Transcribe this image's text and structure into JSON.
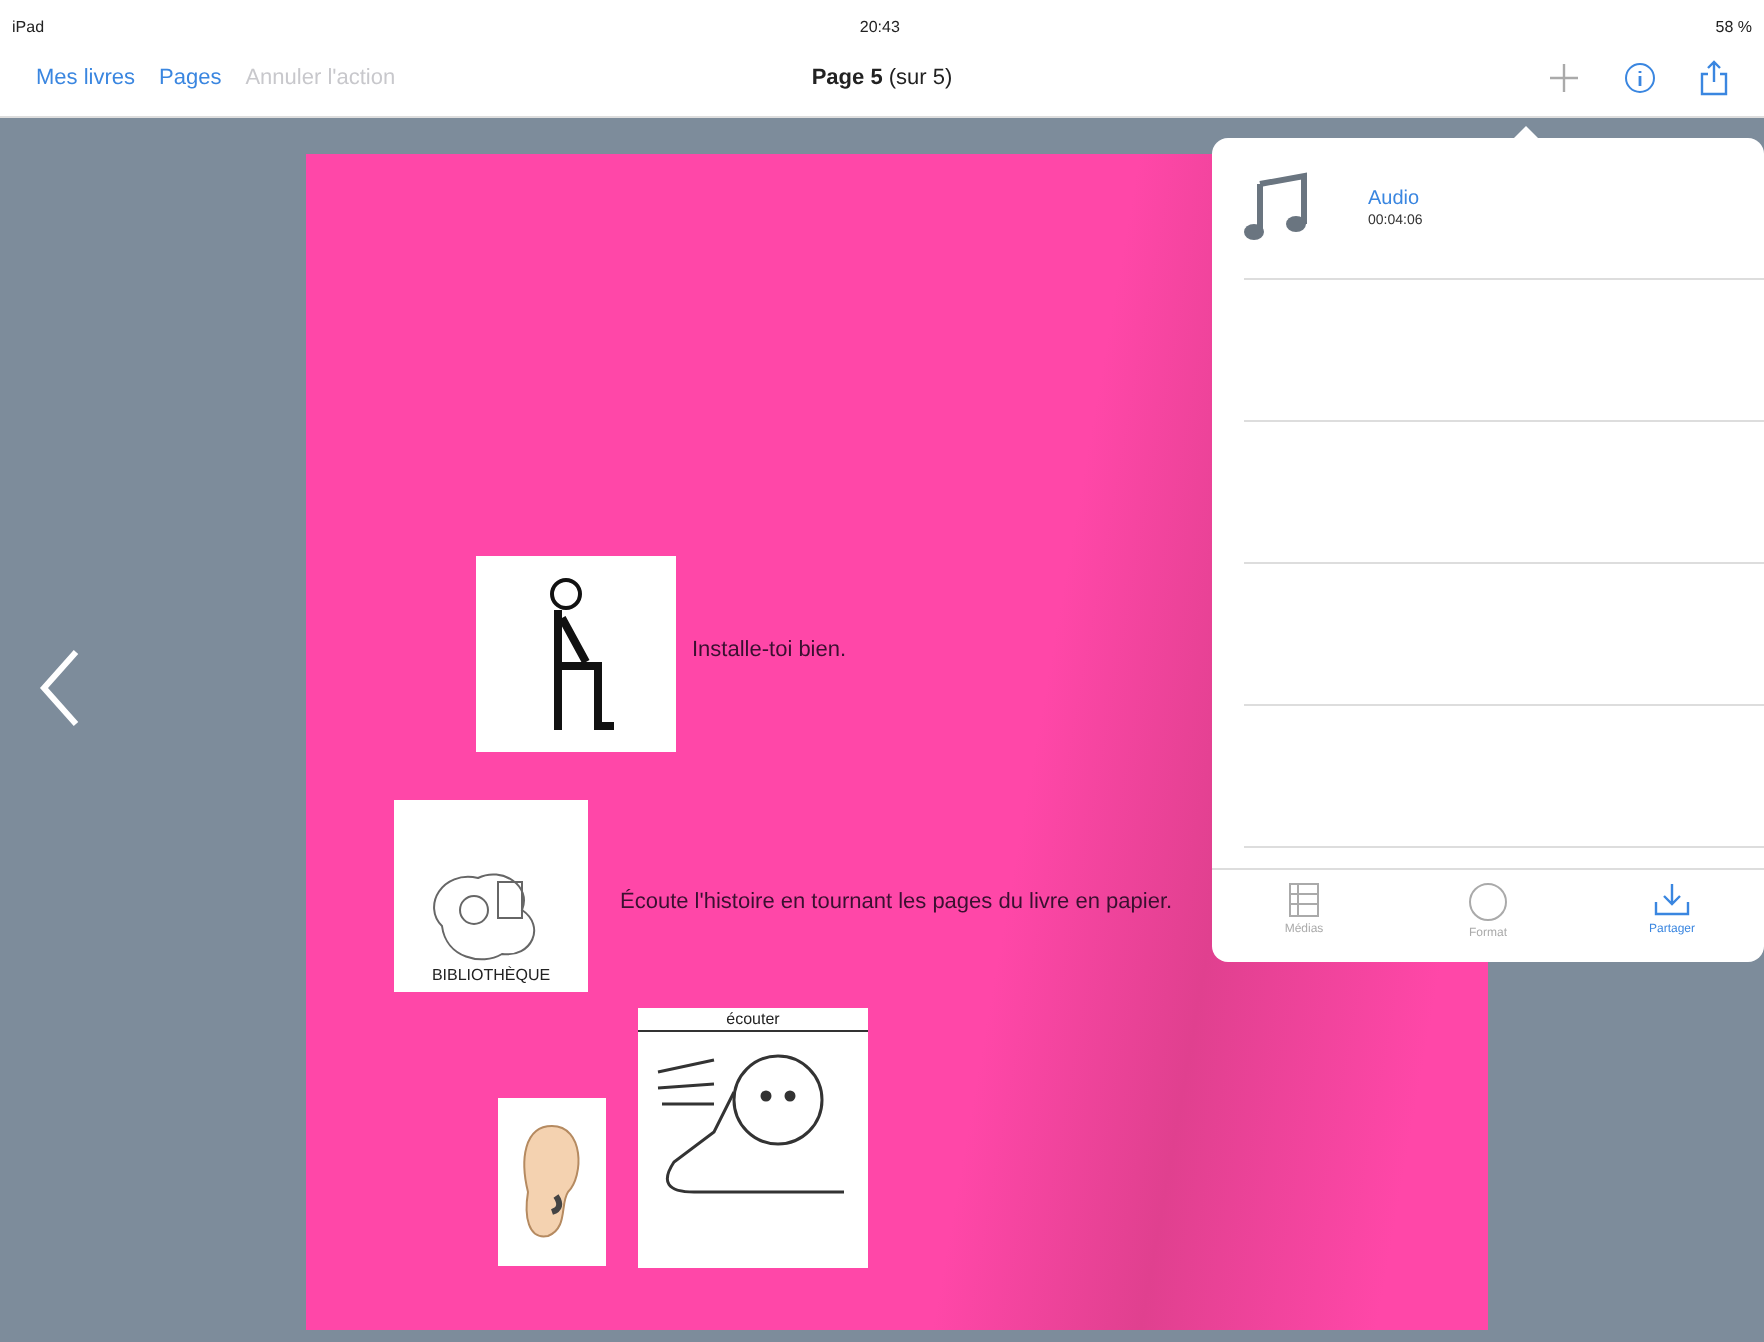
{
  "status_bar": {
    "carrier": "iPad",
    "time": "20:43",
    "battery": "58 %"
  },
  "nav_bar": {
    "left_buttons": [
      {
        "label": "Mes livres",
        "disabled": false
      },
      {
        "label": "Pages",
        "disabled": false
      },
      {
        "label": "Annuler l'action",
        "disabled": true
      }
    ],
    "title_bold": "Page 5",
    "title_rest": "(sur 5)"
  },
  "book_page": {
    "items": [
      {
        "kind": "sitting",
        "text": "Installe-toi bien."
      },
      {
        "kind": "library",
        "caption": "BIBLIOTHÈQUE",
        "text": "Écoute l'histoire en tournant les pages du livre en papier."
      },
      {
        "kind": "ear"
      },
      {
        "kind": "listen",
        "caption": "écouter"
      }
    ]
  },
  "popover": {
    "rows": [
      {
        "title": "Audio",
        "duration": "00:04:06"
      },
      {},
      {},
      {},
      {}
    ],
    "tabs": [
      {
        "label": "Médias",
        "selected": false
      },
      {
        "label": "Format",
        "selected": false
      },
      {
        "label": "Partager",
        "selected": true
      }
    ]
  }
}
